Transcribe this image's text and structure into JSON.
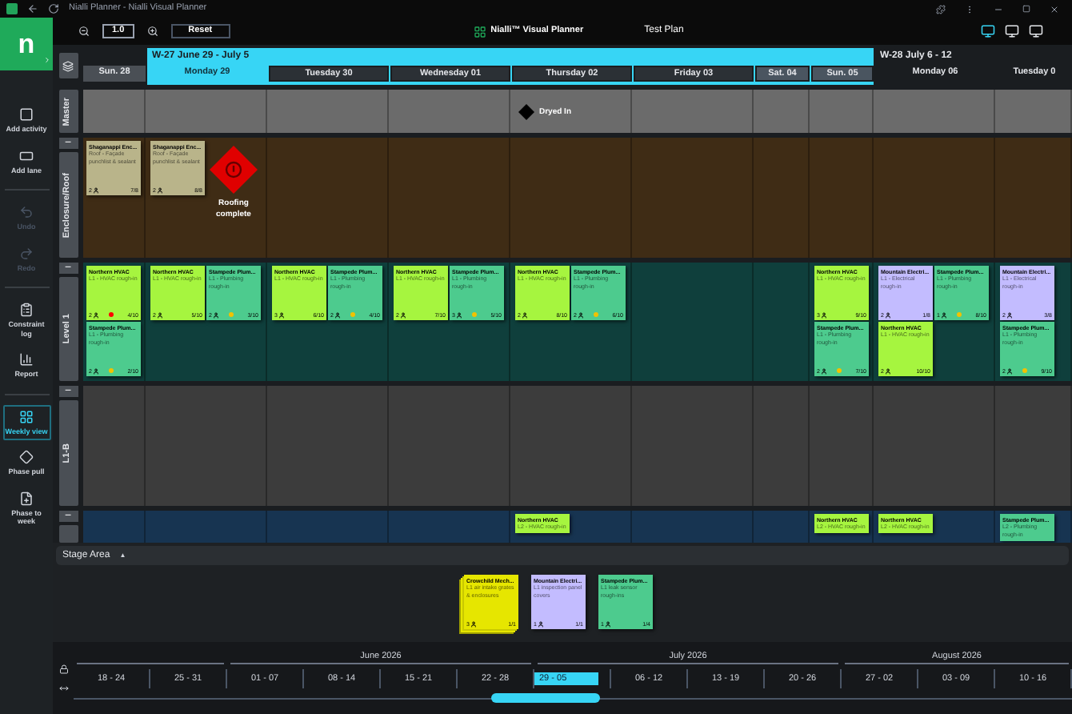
{
  "window": {
    "title": "Nialli Planner - Nialli Visual Planner"
  },
  "toolbar": {
    "zoom": "1.0",
    "reset": "Reset",
    "logo": "Nialli™ Visual Planner",
    "plan": "Test Plan"
  },
  "sidebar": {
    "logo": "n",
    "items": [
      {
        "label": "Add activity",
        "selected": false,
        "disabled": false
      },
      {
        "label": "Add lane",
        "selected": false,
        "disabled": false
      },
      {
        "label": "Undo",
        "selected": false,
        "disabled": true
      },
      {
        "label": "Redo",
        "selected": false,
        "disabled": true
      },
      {
        "label": "Constraint log",
        "selected": false,
        "disabled": false
      },
      {
        "label": "Report",
        "selected": false,
        "disabled": false
      },
      {
        "label": "Weekly view",
        "selected": true,
        "disabled": false
      },
      {
        "label": "Phase pull",
        "selected": false,
        "disabled": false
      },
      {
        "label": "Phase to week",
        "selected": false,
        "disabled": false
      }
    ]
  },
  "weeks": [
    {
      "selected": false,
      "days": [
        {
          "label": "Sun. 28",
          "kind": "weekend",
          "today": false
        }
      ]
    },
    {
      "label": "W-27 June 29 - July 5",
      "selected": true,
      "days": [
        {
          "label": "Monday 29",
          "kind": "weekday",
          "today": true
        },
        {
          "label": "Tuesday 30",
          "kind": "weekday",
          "today": false
        },
        {
          "label": "Wednesday 01",
          "kind": "weekday",
          "today": false
        },
        {
          "label": "Thursday 02",
          "kind": "weekday",
          "today": false
        },
        {
          "label": "Friday 03",
          "kind": "weekday",
          "today": false
        },
        {
          "label": "Sat. 04",
          "kind": "weekend",
          "today": false
        },
        {
          "label": "Sun. 05",
          "kind": "weekend",
          "today": false
        }
      ]
    },
    {
      "label": "W-28 July 6 - 12",
      "selected": false,
      "days": [
        {
          "label": "Monday 06",
          "kind": "weekday",
          "today": false
        },
        {
          "label": "Tuesday 0",
          "kind": "weekday",
          "today": false
        }
      ]
    }
  ],
  "lanes": [
    {
      "name": "Master",
      "color": "#6b6b6b",
      "cells": [
        {},
        {},
        {},
        {},
        {
          "items": [
            {
              "kind": "milestone",
              "label": "Dryed In",
              "color": "#000000"
            }
          ]
        },
        {},
        {},
        {},
        {},
        {}
      ]
    },
    {
      "name": "Enclosure/Roof",
      "toggle": "−",
      "color": "#3f2c15",
      "cells": [
        {
          "items": [
            {
              "kind": "card",
              "company": "Shaganappi Enc...",
              "task": "Roof - Façade punchlist & sealant",
              "crew": "2",
              "progress": "7/8",
              "color": "#b9b48a"
            }
          ]
        },
        {
          "items": [
            {
              "kind": "card",
              "company": "Shaganappi Enc...",
              "task": "Roof - Façade punchlist & sealant",
              "crew": "2",
              "progress": "8/8",
              "color": "#b9b48a"
            },
            {
              "kind": "alert_milestone",
              "label": "Roofing complete",
              "color": "#e00000"
            }
          ]
        },
        {},
        {},
        {},
        {},
        {},
        {},
        {},
        {}
      ]
    },
    {
      "name": "Level 1",
      "toggle": "−",
      "color": "#0f3f3c",
      "cells": [
        {
          "items": [
            {
              "kind": "card",
              "company": "Northern HVAC",
              "task": "L1 - HVAC rough-in",
              "crew": "2",
              "progress": "4/10",
              "color": "#a6f53f",
              "status_dot": {
                "color": "#ff0000"
              }
            },
            {
              "kind": "card",
              "company": "Stampede Plum...",
              "task": "L1 - Plumbing rough-in",
              "crew": "2",
              "progress": "2/10",
              "color": "#4dcb8e",
              "status_dot": {
                "color": "#f2c200"
              }
            }
          ]
        },
        {
          "items": [
            {
              "kind": "card",
              "company": "Northern HVAC",
              "task": "L1 - HVAC rough-in",
              "crew": "2",
              "progress": "5/10",
              "color": "#a6f53f"
            },
            {
              "kind": "card",
              "company": "Stampede Plum...",
              "task": "L1 - Plumbing rough-in",
              "crew": "2",
              "progress": "3/10",
              "color": "#4dcb8e",
              "status_dot": {
                "color": "#f2c200"
              }
            }
          ]
        },
        {
          "items": [
            {
              "kind": "card",
              "company": "Northern HVAC",
              "task": "L1 - HVAC rough-in",
              "crew": "3",
              "progress": "6/10",
              "color": "#a6f53f"
            },
            {
              "kind": "card",
              "company": "Stampede Plum...",
              "task": "L1 - Plumbing rough-in",
              "crew": "2",
              "progress": "4/10",
              "color": "#4dcb8e",
              "status_dot": {
                "color": "#f2c200"
              }
            }
          ]
        },
        {
          "items": [
            {
              "kind": "card",
              "company": "Northern HVAC",
              "task": "L1 - HVAC rough-in",
              "crew": "2",
              "progress": "7/10",
              "color": "#a6f53f"
            },
            {
              "kind": "card",
              "company": "Stampede Plum...",
              "task": "L1 - Plumbing rough-in",
              "crew": "3",
              "progress": "5/10",
              "color": "#4dcb8e",
              "status_dot": {
                "color": "#f2c200"
              }
            }
          ]
        },
        {
          "items": [
            {
              "kind": "card",
              "company": "Northern HVAC",
              "task": "L1 - HVAC rough-in",
              "crew": "2",
              "progress": "8/10",
              "color": "#a6f53f"
            },
            {
              "kind": "card",
              "company": "Stampede Plum...",
              "task": "L1 - Plumbing rough-in",
              "crew": "2",
              "progress": "6/10",
              "color": "#4dcb8e",
              "status_dot": {
                "color": "#f2c200"
              }
            }
          ]
        },
        {},
        {},
        {
          "items": [
            {
              "kind": "card",
              "company": "Northern HVAC",
              "task": "L1 - HVAC rough-in",
              "crew": "3",
              "progress": "9/10",
              "color": "#a6f53f"
            },
            {
              "kind": "card",
              "company": "Stampede Plum...",
              "task": "L1 - Plumbing rough-in",
              "crew": "2",
              "progress": "7/10",
              "color": "#4dcb8e",
              "status_dot": {
                "color": "#f2c200"
              }
            }
          ]
        },
        {
          "items": [
            {
              "kind": "card",
              "company": "Mountain Electri...",
              "task": "L1 - Electrical rough-in",
              "crew": "2",
              "progress": "1/8",
              "color": "#c3bcff"
            },
            {
              "kind": "card",
              "company": "Stampede Plum...",
              "task": "L1 - Plumbing rough-in",
              "crew": "1",
              "progress": "8/10",
              "color": "#4dcb8e",
              "status_dot": {
                "color": "#f2c200"
              }
            },
            {
              "kind": "card",
              "company": "Northern HVAC",
              "task": "L1 - HVAC rough-in",
              "crew": "2",
              "progress": "10/10",
              "color": "#a6f53f"
            }
          ]
        },
        {
          "items": [
            {
              "kind": "card",
              "company": "Mountain Electri...",
              "task": "L1 - Electrical rough-in",
              "crew": "2",
              "progress": "3/8",
              "color": "#c3bcff"
            },
            {
              "kind": "card",
              "company": "Stampede Plum...",
              "task": "L1 - Plumbing rough-in",
              "crew": "2",
              "progress": "9/10",
              "color": "#4dcb8e",
              "status_dot": {
                "color": "#f2c200"
              }
            }
          ]
        }
      ]
    },
    {
      "name": "L1-B",
      "toggle": "−",
      "color": "#3c3c3c",
      "cells": [
        {},
        {},
        {},
        {},
        {},
        {},
        {},
        {},
        {},
        {}
      ]
    },
    {
      "toggle": "−",
      "color": "#173451",
      "cells": [
        {},
        {},
        {},
        {},
        {
          "items": [
            {
              "kind": "card",
              "company": "Northern HVAC",
              "task": "L2 - HVAC rough-in",
              "color": "#a6f53f"
            }
          ]
        },
        {},
        {},
        {
          "items": [
            {
              "kind": "card",
              "company": "Northern HVAC",
              "task": "L2 - HVAC rough-in",
              "color": "#a6f53f"
            }
          ]
        },
        {
          "items": [
            {
              "kind": "card",
              "company": "Northern HVAC",
              "task": "L2 - HVAC rough-in",
              "color": "#a6f53f"
            }
          ]
        },
        {
          "items": [
            {
              "kind": "card",
              "company": "Stampede Plum...",
              "task": "L2 - Plumbing rough-in",
              "color": "#4dcb8e"
            }
          ]
        }
      ]
    }
  ],
  "stage": {
    "title": "Stage Area",
    "caret": "▲",
    "expanded": true,
    "cards": [
      {
        "kind": "stack",
        "company": "Crowchild Mech...",
        "task": "L1 air intake grates & enclosures",
        "crew": "3",
        "progress": "1/1",
        "color": "#e6e600"
      },
      {
        "kind": "card",
        "company": "Mountain Electri...",
        "task": "L1 inspection panel covers",
        "crew": "1",
        "progress": "1/1",
        "color": "#c3bcff"
      },
      {
        "kind": "card",
        "company": "Stampede Plum...",
        "task": "L1 leak sensor rough-ins",
        "crew": "1",
        "progress": "1/4",
        "color": "#4dcb8e"
      }
    ]
  },
  "timeline": {
    "months": [
      {
        "weeks": [
          {
            "label": "18 - 24",
            "selected": false
          },
          {
            "label": "25 - 31",
            "selected": false
          }
        ]
      },
      {
        "label": "June 2026",
        "weeks": [
          {
            "label": "01 - 07",
            "selected": false
          },
          {
            "label": "08 - 14",
            "selected": false
          },
          {
            "label": "15 - 21",
            "selected": false
          },
          {
            "label": "22 - 28",
            "selected": false
          }
        ]
      },
      {
        "label": "July 2026",
        "weeks": [
          {
            "label": "29 - 05",
            "selected": true
          },
          {
            "label": "06 - 12",
            "selected": false
          },
          {
            "label": "13 - 19",
            "selected": false
          },
          {
            "label": "20 - 26",
            "selected": false
          }
        ]
      },
      {
        "label": "August 2026",
        "weeks": [
          {
            "label": "27 - 02",
            "selected": false
          },
          {
            "label": "03 - 09",
            "selected": false
          },
          {
            "label": "10 - 16",
            "selected": false
          }
        ]
      }
    ]
  }
}
